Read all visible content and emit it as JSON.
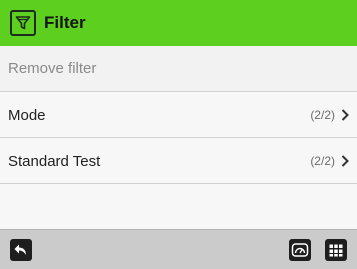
{
  "header": {
    "title": "Filter",
    "icon": "funnel-icon",
    "color": "#5ccf1f"
  },
  "rows": [
    {
      "label": "Remove filter",
      "disabled": true
    },
    {
      "label": "Mode",
      "count": "(2/2)",
      "icon": "chevron-right-icon"
    },
    {
      "label": "Standard Test",
      "count": "(2/2)",
      "icon": "chevron-right-icon"
    }
  ],
  "footer": {
    "back_icon": "back-arrow-icon",
    "gauge_icon": "speedometer-icon",
    "menu_icon": "grid-menu-icon"
  }
}
